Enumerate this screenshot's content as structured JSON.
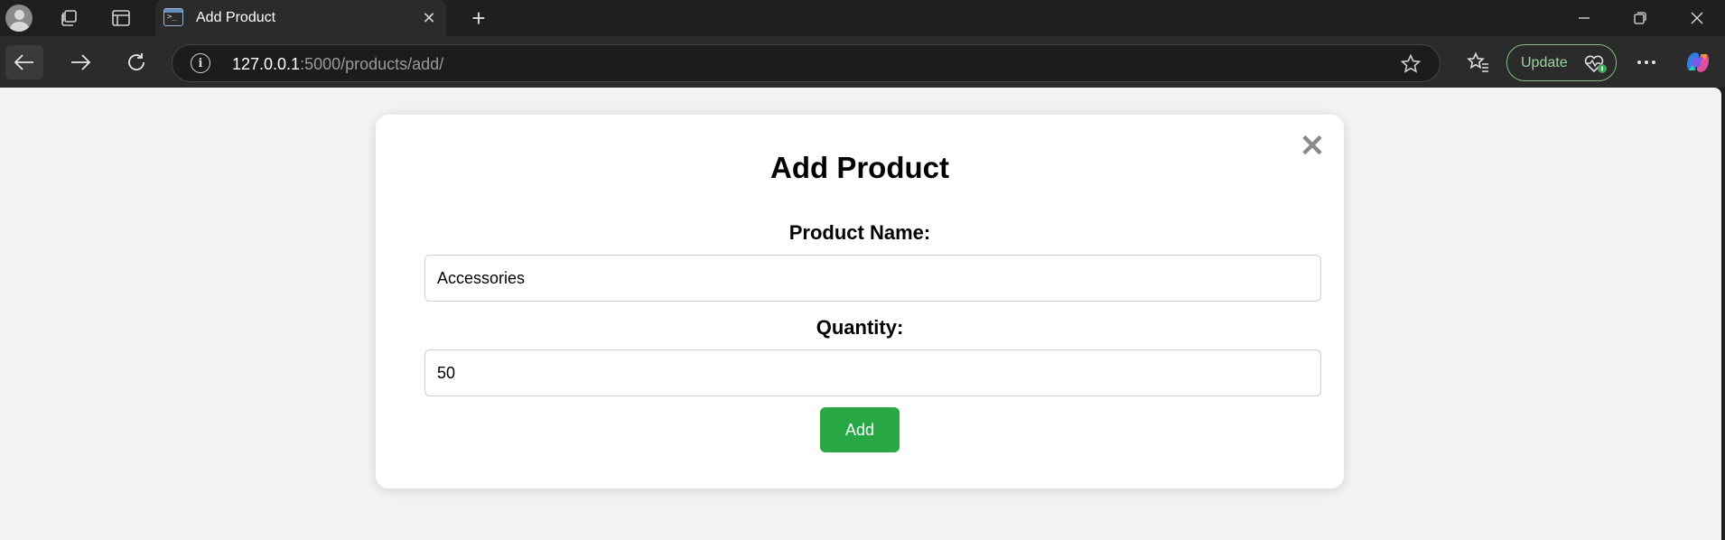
{
  "browser": {
    "tab": {
      "title": "Add Product",
      "favicon": "terminal-icon"
    },
    "address": {
      "host": "127.0.0.1",
      "rest": ":5000/products/add/"
    },
    "update_label": "Update",
    "accent": "#9fd49f"
  },
  "form": {
    "title": "Add Product",
    "product_name": {
      "label": "Product Name:",
      "value": "Accessories"
    },
    "quantity": {
      "label": "Quantity:",
      "value": "50"
    },
    "submit_label": "Add",
    "close_glyph": "✕",
    "button_color": "#28a745"
  }
}
